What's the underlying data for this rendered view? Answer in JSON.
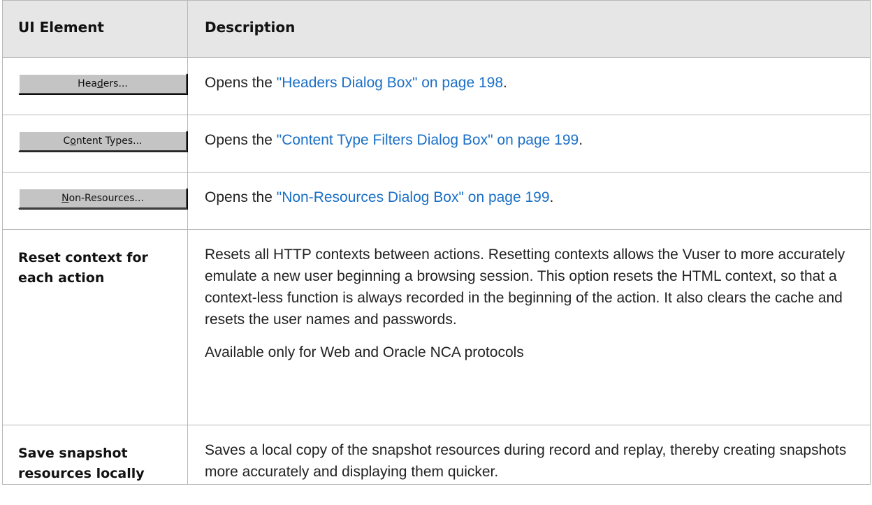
{
  "table": {
    "headers": {
      "element": "UI Element",
      "description": "Description"
    },
    "rows": [
      {
        "button": {
          "before": "Hea",
          "mnemonic": "d",
          "after": "ers..."
        },
        "desc_prefix": "Opens the ",
        "desc_link": "\"Headers Dialog Box\" on page 198",
        "desc_suffix": "."
      },
      {
        "button": {
          "before": "C",
          "mnemonic": "o",
          "after": "ntent Types..."
        },
        "desc_prefix": "Opens the ",
        "desc_link": "\"Content Type Filters Dialog Box\" on page 199",
        "desc_suffix": "."
      },
      {
        "button": {
          "before": "",
          "mnemonic": "N",
          "after": "on-Resources..."
        },
        "desc_prefix": "Opens the ",
        "desc_link": "\"Non-Resources Dialog Box\" on page 199",
        "desc_suffix": "."
      },
      {
        "element": "Reset context for each action",
        "desc_p1": "Resets all HTTP contexts between actions. Resetting contexts allows the Vuser to more accurately emulate a new user beginning a browsing session. This option resets the HTML context, so that a context-less function is always recorded in the beginning of the action. It also clears the cache and resets the user names and passwords.",
        "desc_p2": "Available only for Web and Oracle NCA protocols"
      },
      {
        "element": "Save snapshot resources locally",
        "desc_p1": "Saves a local copy of the snapshot resources during record and replay, thereby creating snapshots more accurately and displaying them quicker."
      }
    ]
  },
  "colors": {
    "header_bg": "#e6e6e6",
    "border": "#b8b8b8",
    "link": "#1a6fc7",
    "button_face": "#c4c4c4"
  }
}
